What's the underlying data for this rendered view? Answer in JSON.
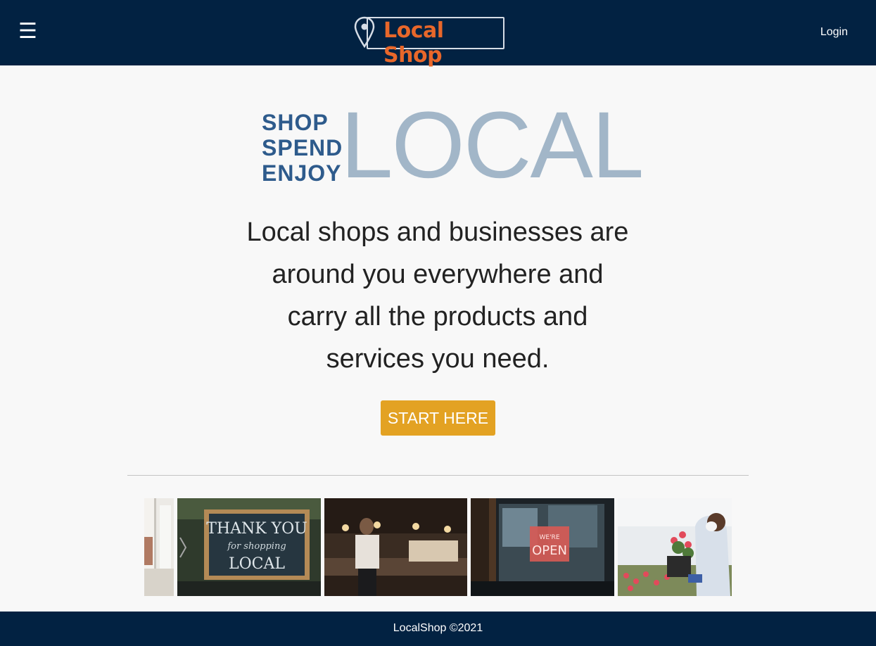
{
  "header": {
    "menu_icon": "hamburger-menu-icon",
    "logo_text": "Local Shop",
    "login_label": "Login",
    "colors": {
      "bar": "#022242",
      "logo_accent": "#e8672a"
    }
  },
  "hero": {
    "tagline": [
      "SHOP",
      "SPEND",
      "ENJOY"
    ],
    "wordmark": "LOCAL",
    "description_lines": [
      "Local shops and businesses are",
      "around you everywhere and",
      "carry all the products and",
      "services you need."
    ],
    "cta_label": "START HERE",
    "colors": {
      "tagline": "#2e5b8c",
      "wordmark": "#a2b6c8",
      "cta": "#e3a223"
    }
  },
  "gallery": {
    "slides": [
      {
        "name": "storefront-partial"
      },
      {
        "name": "thank-you-sign",
        "sign_lines": [
          "THANK YOU",
          "for shopping",
          "LOCAL"
        ]
      },
      {
        "name": "restaurant-kitchen"
      },
      {
        "name": "open-sign",
        "sign_lines": [
          "WE'RE",
          "OPEN"
        ]
      },
      {
        "name": "florist"
      }
    ]
  },
  "footer": {
    "text": "LocalShop ©2021"
  }
}
